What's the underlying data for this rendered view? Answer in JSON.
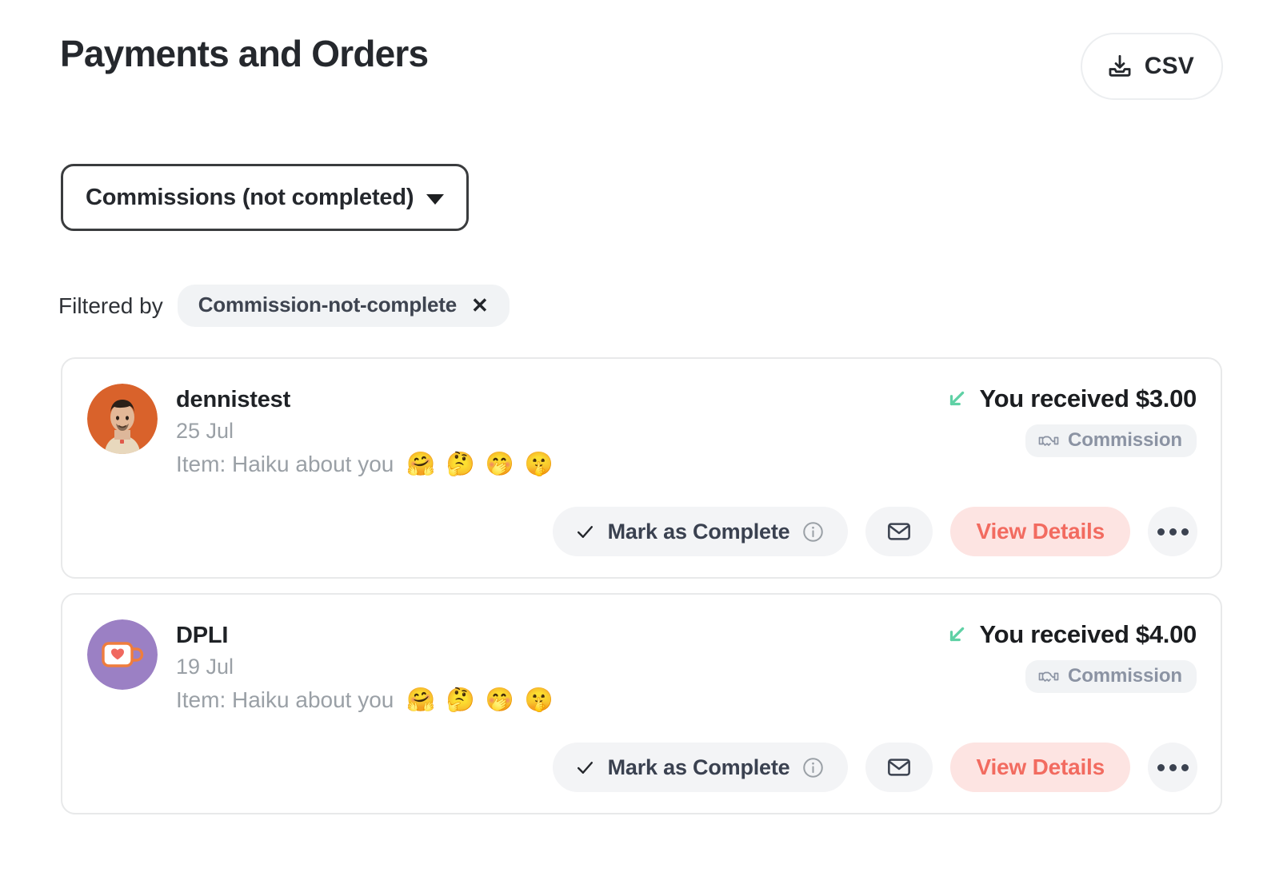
{
  "header": {
    "title": "Payments and Orders",
    "csv_button_label": "CSV",
    "csv_icon": "download-tray-icon"
  },
  "filter_select": {
    "value": "Commissions (not completed)",
    "caret_icon": "chevron-down-icon"
  },
  "filters": {
    "label": "Filtered by",
    "chip": {
      "text": "Commission-not-complete",
      "remove_icon": "close-icon",
      "remove_glyph": "✕"
    }
  },
  "colors": {
    "accent_red": "#f26b60",
    "accent_red_bg": "#fde4e2",
    "green_arrow": "#5fd1a5",
    "chip_bg": "#f1f3f5",
    "card_border": "#e8e9ea",
    "text_dark": "#25282d",
    "text_muted": "#9aa0a6",
    "badge_text": "#8b93a3",
    "avatar_orange": "#d9622b",
    "avatar_purple": "#9b80c4"
  },
  "actions": {
    "mark_complete_label": "Mark as Complete",
    "view_details_label": "View Details",
    "check_icon": "check-icon",
    "info_icon": "info-circle-icon",
    "mail_icon": "envelope-icon",
    "more_icon": "ellipsis-icon"
  },
  "orders": [
    {
      "user": "dennistest",
      "date": "25 Jul",
      "item_prefix": "Item: Haiku about you",
      "item_emojis": [
        "🤗",
        "🤔",
        "🤭",
        "🤫"
      ],
      "amount_text": "You received $3.00",
      "amount_icon": "arrow-down-left-icon",
      "badge_label": "Commission",
      "badge_icon": "handshake-icon",
      "avatar_type": "person-avatar",
      "avatar_color": "#d9622b"
    },
    {
      "user": "DPLI",
      "date": "19 Jul",
      "item_prefix": "Item: Haiku about you",
      "item_emojis": [
        "🤗",
        "🤔",
        "🤭",
        "🤫"
      ],
      "amount_text": "You received $4.00",
      "amount_icon": "arrow-down-left-icon",
      "badge_label": "Commission",
      "badge_icon": "handshake-icon",
      "avatar_type": "kofi-cup-avatar",
      "avatar_color": "#9b80c4"
    }
  ]
}
